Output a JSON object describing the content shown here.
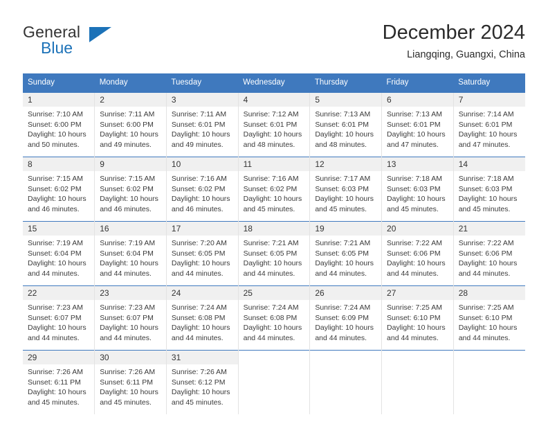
{
  "brand": {
    "name_top": "General",
    "name_bottom": "Blue",
    "triangle_icon": "triangle-icon",
    "accent_color": "#1c72b8"
  },
  "header": {
    "title": "December 2024",
    "subtitle": "Liangqing, Guangxi, China"
  },
  "calendar": {
    "header_bg": "#3f79be",
    "daynum_bg": "#f0f0f0",
    "weekdays": [
      "Sunday",
      "Monday",
      "Tuesday",
      "Wednesday",
      "Thursday",
      "Friday",
      "Saturday"
    ],
    "weeks": [
      [
        {
          "day": "1",
          "sunrise": "Sunrise: 7:10 AM",
          "sunset": "Sunset: 6:00 PM",
          "daylight1": "Daylight: 10 hours",
          "daylight2": "and 50 minutes."
        },
        {
          "day": "2",
          "sunrise": "Sunrise: 7:11 AM",
          "sunset": "Sunset: 6:00 PM",
          "daylight1": "Daylight: 10 hours",
          "daylight2": "and 49 minutes."
        },
        {
          "day": "3",
          "sunrise": "Sunrise: 7:11 AM",
          "sunset": "Sunset: 6:01 PM",
          "daylight1": "Daylight: 10 hours",
          "daylight2": "and 49 minutes."
        },
        {
          "day": "4",
          "sunrise": "Sunrise: 7:12 AM",
          "sunset": "Sunset: 6:01 PM",
          "daylight1": "Daylight: 10 hours",
          "daylight2": "and 48 minutes."
        },
        {
          "day": "5",
          "sunrise": "Sunrise: 7:13 AM",
          "sunset": "Sunset: 6:01 PM",
          "daylight1": "Daylight: 10 hours",
          "daylight2": "and 48 minutes."
        },
        {
          "day": "6",
          "sunrise": "Sunrise: 7:13 AM",
          "sunset": "Sunset: 6:01 PM",
          "daylight1": "Daylight: 10 hours",
          "daylight2": "and 47 minutes."
        },
        {
          "day": "7",
          "sunrise": "Sunrise: 7:14 AM",
          "sunset": "Sunset: 6:01 PM",
          "daylight1": "Daylight: 10 hours",
          "daylight2": "and 47 minutes."
        }
      ],
      [
        {
          "day": "8",
          "sunrise": "Sunrise: 7:15 AM",
          "sunset": "Sunset: 6:02 PM",
          "daylight1": "Daylight: 10 hours",
          "daylight2": "and 46 minutes."
        },
        {
          "day": "9",
          "sunrise": "Sunrise: 7:15 AM",
          "sunset": "Sunset: 6:02 PM",
          "daylight1": "Daylight: 10 hours",
          "daylight2": "and 46 minutes."
        },
        {
          "day": "10",
          "sunrise": "Sunrise: 7:16 AM",
          "sunset": "Sunset: 6:02 PM",
          "daylight1": "Daylight: 10 hours",
          "daylight2": "and 46 minutes."
        },
        {
          "day": "11",
          "sunrise": "Sunrise: 7:16 AM",
          "sunset": "Sunset: 6:02 PM",
          "daylight1": "Daylight: 10 hours",
          "daylight2": "and 45 minutes."
        },
        {
          "day": "12",
          "sunrise": "Sunrise: 7:17 AM",
          "sunset": "Sunset: 6:03 PM",
          "daylight1": "Daylight: 10 hours",
          "daylight2": "and 45 minutes."
        },
        {
          "day": "13",
          "sunrise": "Sunrise: 7:18 AM",
          "sunset": "Sunset: 6:03 PM",
          "daylight1": "Daylight: 10 hours",
          "daylight2": "and 45 minutes."
        },
        {
          "day": "14",
          "sunrise": "Sunrise: 7:18 AM",
          "sunset": "Sunset: 6:03 PM",
          "daylight1": "Daylight: 10 hours",
          "daylight2": "and 45 minutes."
        }
      ],
      [
        {
          "day": "15",
          "sunrise": "Sunrise: 7:19 AM",
          "sunset": "Sunset: 6:04 PM",
          "daylight1": "Daylight: 10 hours",
          "daylight2": "and 44 minutes."
        },
        {
          "day": "16",
          "sunrise": "Sunrise: 7:19 AM",
          "sunset": "Sunset: 6:04 PM",
          "daylight1": "Daylight: 10 hours",
          "daylight2": "and 44 minutes."
        },
        {
          "day": "17",
          "sunrise": "Sunrise: 7:20 AM",
          "sunset": "Sunset: 6:05 PM",
          "daylight1": "Daylight: 10 hours",
          "daylight2": "and 44 minutes."
        },
        {
          "day": "18",
          "sunrise": "Sunrise: 7:21 AM",
          "sunset": "Sunset: 6:05 PM",
          "daylight1": "Daylight: 10 hours",
          "daylight2": "and 44 minutes."
        },
        {
          "day": "19",
          "sunrise": "Sunrise: 7:21 AM",
          "sunset": "Sunset: 6:05 PM",
          "daylight1": "Daylight: 10 hours",
          "daylight2": "and 44 minutes."
        },
        {
          "day": "20",
          "sunrise": "Sunrise: 7:22 AM",
          "sunset": "Sunset: 6:06 PM",
          "daylight1": "Daylight: 10 hours",
          "daylight2": "and 44 minutes."
        },
        {
          "day": "21",
          "sunrise": "Sunrise: 7:22 AM",
          "sunset": "Sunset: 6:06 PM",
          "daylight1": "Daylight: 10 hours",
          "daylight2": "and 44 minutes."
        }
      ],
      [
        {
          "day": "22",
          "sunrise": "Sunrise: 7:23 AM",
          "sunset": "Sunset: 6:07 PM",
          "daylight1": "Daylight: 10 hours",
          "daylight2": "and 44 minutes."
        },
        {
          "day": "23",
          "sunrise": "Sunrise: 7:23 AM",
          "sunset": "Sunset: 6:07 PM",
          "daylight1": "Daylight: 10 hours",
          "daylight2": "and 44 minutes."
        },
        {
          "day": "24",
          "sunrise": "Sunrise: 7:24 AM",
          "sunset": "Sunset: 6:08 PM",
          "daylight1": "Daylight: 10 hours",
          "daylight2": "and 44 minutes."
        },
        {
          "day": "25",
          "sunrise": "Sunrise: 7:24 AM",
          "sunset": "Sunset: 6:08 PM",
          "daylight1": "Daylight: 10 hours",
          "daylight2": "and 44 minutes."
        },
        {
          "day": "26",
          "sunrise": "Sunrise: 7:24 AM",
          "sunset": "Sunset: 6:09 PM",
          "daylight1": "Daylight: 10 hours",
          "daylight2": "and 44 minutes."
        },
        {
          "day": "27",
          "sunrise": "Sunrise: 7:25 AM",
          "sunset": "Sunset: 6:10 PM",
          "daylight1": "Daylight: 10 hours",
          "daylight2": "and 44 minutes."
        },
        {
          "day": "28",
          "sunrise": "Sunrise: 7:25 AM",
          "sunset": "Sunset: 6:10 PM",
          "daylight1": "Daylight: 10 hours",
          "daylight2": "and 44 minutes."
        }
      ],
      [
        {
          "day": "29",
          "sunrise": "Sunrise: 7:26 AM",
          "sunset": "Sunset: 6:11 PM",
          "daylight1": "Daylight: 10 hours",
          "daylight2": "and 45 minutes."
        },
        {
          "day": "30",
          "sunrise": "Sunrise: 7:26 AM",
          "sunset": "Sunset: 6:11 PM",
          "daylight1": "Daylight: 10 hours",
          "daylight2": "and 45 minutes."
        },
        {
          "day": "31",
          "sunrise": "Sunrise: 7:26 AM",
          "sunset": "Sunset: 6:12 PM",
          "daylight1": "Daylight: 10 hours",
          "daylight2": "and 45 minutes."
        },
        {
          "day": "",
          "sunrise": "",
          "sunset": "",
          "daylight1": "",
          "daylight2": ""
        },
        {
          "day": "",
          "sunrise": "",
          "sunset": "",
          "daylight1": "",
          "daylight2": ""
        },
        {
          "day": "",
          "sunrise": "",
          "sunset": "",
          "daylight1": "",
          "daylight2": ""
        },
        {
          "day": "",
          "sunrise": "",
          "sunset": "",
          "daylight1": "",
          "daylight2": ""
        }
      ]
    ]
  }
}
